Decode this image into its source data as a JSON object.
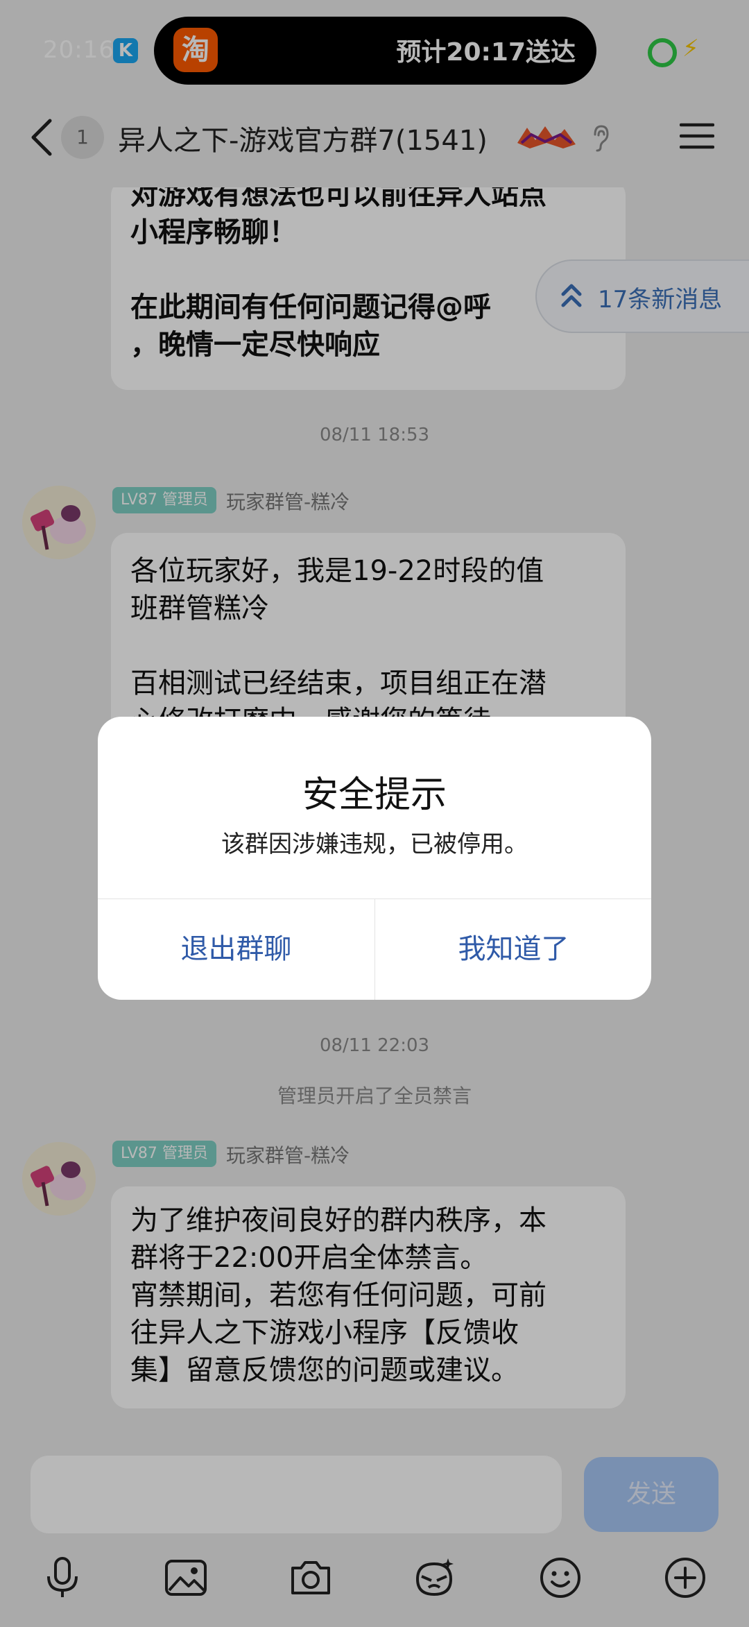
{
  "status_bar": {
    "time": "20:16",
    "k_label": "K",
    "taobao_label": "淘",
    "eta": "预计20:17送达"
  },
  "header": {
    "unread_count": "1",
    "title": "异人之下-游戏官方群7(1541)"
  },
  "new_messages": {
    "label": "17条新消息"
  },
  "messages": [
    {
      "text": "对游戏有想法也可以前往异人站点\n小程序畅聊！\n\n在此期间有任何问题记得@呼\n，晚情一定尽快响应"
    },
    {
      "timestamp": "08/11 18:53",
      "tag": "LV87 管理员",
      "sender": "玩家群管-糕冷",
      "text": "各位玩家好，我是19-22时段的值\n班群管糕冷\n\n百相测试已经结束，项目组正在潜\n心修改打磨中，感谢您的等待"
    },
    {
      "timestamp": "08/11 22:03",
      "system": "管理员开启了全员禁言"
    },
    {
      "tag": "LV87 管理员",
      "sender": "玩家群管-糕冷",
      "text": "为了维护夜间良好的群内秩序，本\n群将于22:00开启全体禁言。\n宵禁期间，若您有任何问题，可前\n往异人之下游戏小程序【反馈收\n集】留意反馈您的问题或建议。"
    }
  ],
  "dialog": {
    "title": "安全提示",
    "message": "该群因涉嫌违规，已被停用。",
    "exit_label": "退出群聊",
    "ok_label": "我知道了"
  },
  "input_bar": {
    "placeholder": "",
    "send_label": "发送"
  },
  "toolbar": [
    "mic-icon",
    "image-icon",
    "camera-icon",
    "sticker-icon",
    "emoji-icon",
    "plus-icon"
  ]
}
